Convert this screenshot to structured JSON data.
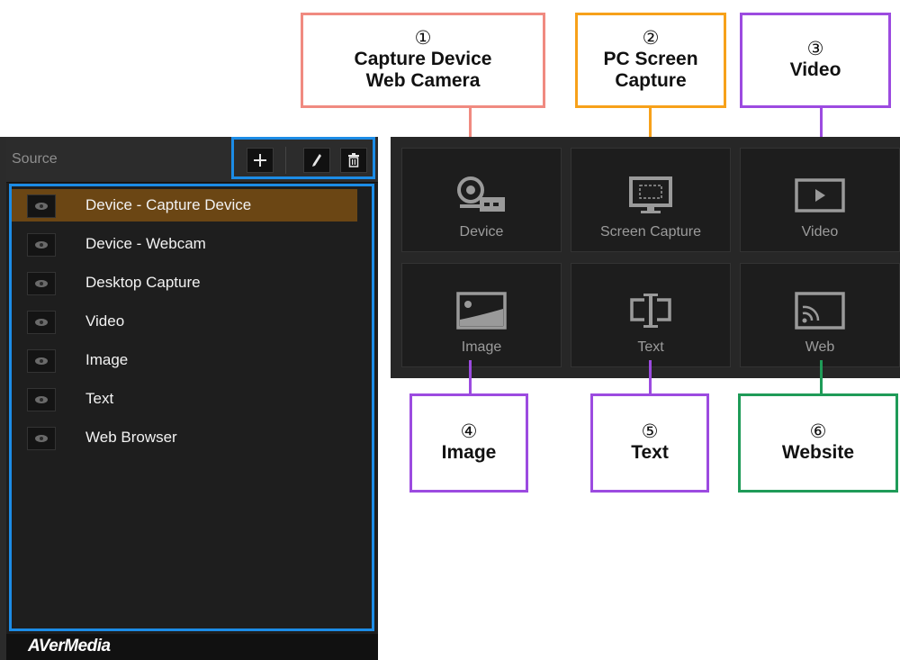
{
  "colors": {
    "panel_bg": "#1e1e1e",
    "highlight_blue": "#1c8ce6",
    "selected_row": "#6b4614",
    "callout_red": "#f08a80",
    "callout_orange": "#f7a11a",
    "callout_purple": "#9c4be0",
    "callout_green": "#1f9b58"
  },
  "source_panel": {
    "title": "Source",
    "toolbar": {
      "add_icon": "plus-icon",
      "edit_icon": "pencil-icon",
      "delete_icon": "trash-icon"
    },
    "items": [
      {
        "label": "Device - Capture Device",
        "selected": true
      },
      {
        "label": "Device - Webcam",
        "selected": false
      },
      {
        "label": "Desktop Capture",
        "selected": false
      },
      {
        "label": "Video",
        "selected": false
      },
      {
        "label": "Image",
        "selected": false
      },
      {
        "label": "Text",
        "selected": false
      },
      {
        "label": "Web Browser",
        "selected": false
      }
    ],
    "brand": "AVerMedia"
  },
  "tiles": [
    {
      "label": "Device",
      "icon": "webcam-capture-icon"
    },
    {
      "label": "Screen Capture",
      "icon": "monitor-icon"
    },
    {
      "label": "Video",
      "icon": "play-icon"
    },
    {
      "label": "Image",
      "icon": "image-icon"
    },
    {
      "label": "Text",
      "icon": "text-cursor-icon"
    },
    {
      "label": "Web",
      "icon": "cast-icon"
    }
  ],
  "callouts": [
    {
      "num": "①",
      "line1": "Capture Device",
      "line2": "Web Camera"
    },
    {
      "num": "②",
      "line1": "PC Screen",
      "line2": "Capture"
    },
    {
      "num": "③",
      "line1": "Video",
      "line2": ""
    },
    {
      "num": "④",
      "line1": "Image",
      "line2": ""
    },
    {
      "num": "⑤",
      "line1": "Text",
      "line2": ""
    },
    {
      "num": "⑥",
      "line1": "Website",
      "line2": ""
    }
  ]
}
